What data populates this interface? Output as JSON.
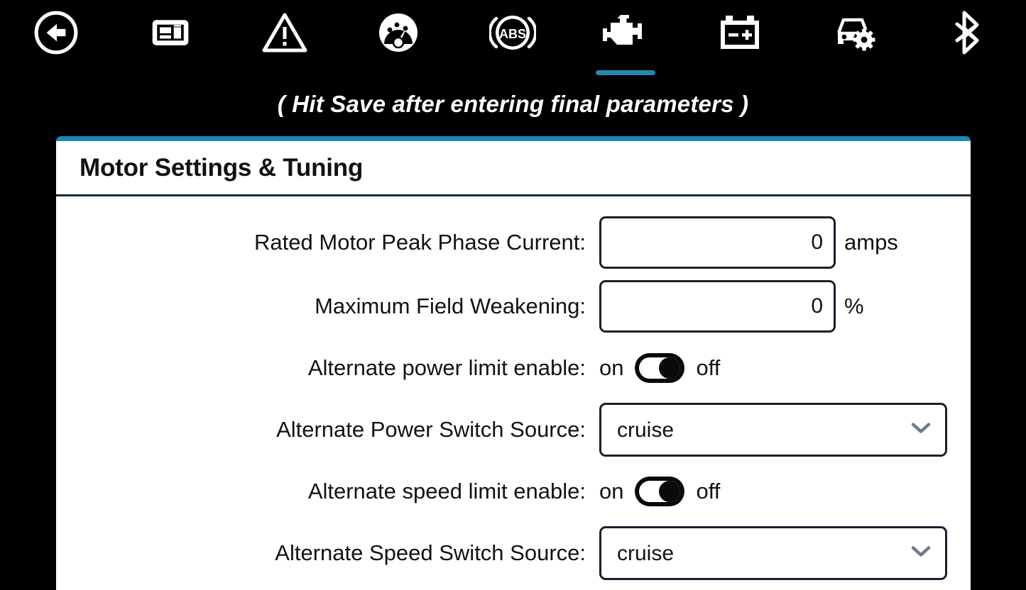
{
  "theme": {
    "background": "#000000",
    "accent": "#1e87ad",
    "card_background": "#ffffff",
    "text": "#121212",
    "chevron": "#707a8c"
  },
  "topnav": {
    "items": [
      {
        "icon": "back-arrow-circle-icon",
        "label": "Back",
        "active": false
      },
      {
        "icon": "dashboard-layout-icon",
        "label": "Dashboard",
        "active": false
      },
      {
        "icon": "warning-triangle-icon",
        "label": "Warnings",
        "active": false
      },
      {
        "icon": "speedometer-gauge-icon",
        "label": "Speed",
        "active": false
      },
      {
        "icon": "abs-brake-icon",
        "label": "ABS",
        "active": false
      },
      {
        "icon": "check-engine-icon",
        "label": "Motor",
        "active": true
      },
      {
        "icon": "battery-icon",
        "label": "Battery",
        "active": false
      },
      {
        "icon": "car-gear-icon",
        "label": "Vehicle Settings",
        "active": false
      },
      {
        "icon": "bluetooth-icon",
        "label": "Bluetooth",
        "active": false
      }
    ]
  },
  "subtitle": "( Hit Save after entering final parameters )",
  "card": {
    "title": "Motor Settings & Tuning",
    "rows": [
      {
        "type": "number",
        "label": "Rated Motor Peak Phase Current:",
        "value": "0",
        "placeholder": "0",
        "unit": "amps"
      },
      {
        "type": "number",
        "label": "Maximum Field Weakening:",
        "value": "0",
        "placeholder": "0",
        "unit": "%"
      },
      {
        "type": "toggle",
        "label": "Alternate power limit enable:",
        "on_label": "on",
        "off_label": "off",
        "state": "off"
      },
      {
        "type": "select",
        "label": "Alternate Power Switch Source:",
        "value": "cruise",
        "options": [
          "cruise"
        ]
      },
      {
        "type": "toggle",
        "label": "Alternate speed limit enable:",
        "on_label": "on",
        "off_label": "off",
        "state": "off"
      },
      {
        "type": "select",
        "label": "Alternate Speed Switch Source:",
        "value": "cruise",
        "options": [
          "cruise"
        ]
      }
    ]
  }
}
